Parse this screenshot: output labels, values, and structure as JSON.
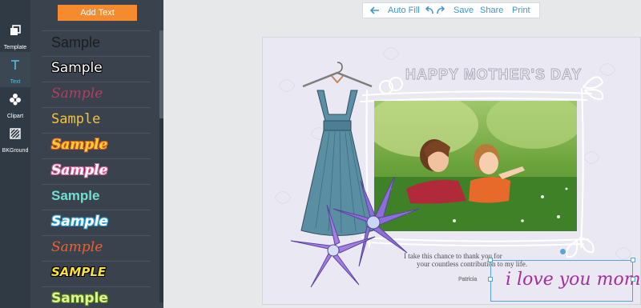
{
  "sidebar": {
    "items": [
      {
        "label": "Template",
        "icon": "template-icon",
        "active": false
      },
      {
        "label": "Text",
        "icon": "text-icon",
        "active": true
      },
      {
        "label": "Clipart",
        "icon": "clipart-icon",
        "active": false
      },
      {
        "label": "BKGround",
        "icon": "background-icon",
        "active": false
      }
    ]
  },
  "text_panel": {
    "add_label": "Add Text",
    "samples": [
      {
        "label": "Sample"
      },
      {
        "label": "Sample"
      },
      {
        "label": "Sample"
      },
      {
        "label": "Sample"
      },
      {
        "label": "Sample"
      },
      {
        "label": "Sample"
      },
      {
        "label": "Sample"
      },
      {
        "label": "Sample"
      },
      {
        "label": "Sample"
      },
      {
        "label": "SAMPLE"
      },
      {
        "label": "Sample"
      }
    ]
  },
  "toolbar": {
    "auto_fill": "Auto Fill",
    "save": "Save",
    "share": "Share",
    "print": "Print"
  },
  "card": {
    "title": "HAPPY MOTHER'S DAY",
    "message_line1": "I take this chance to thank you for",
    "message_line2": "your countless contribution to my life.",
    "signature": "Patricia",
    "selected_text": "i love you mom"
  },
  "colors": {
    "accent": "#f58b2c",
    "link": "#3e97c9",
    "selection": "#58a6cf",
    "panel_bg": "#39424d",
    "rail_bg": "#2f3a45"
  }
}
